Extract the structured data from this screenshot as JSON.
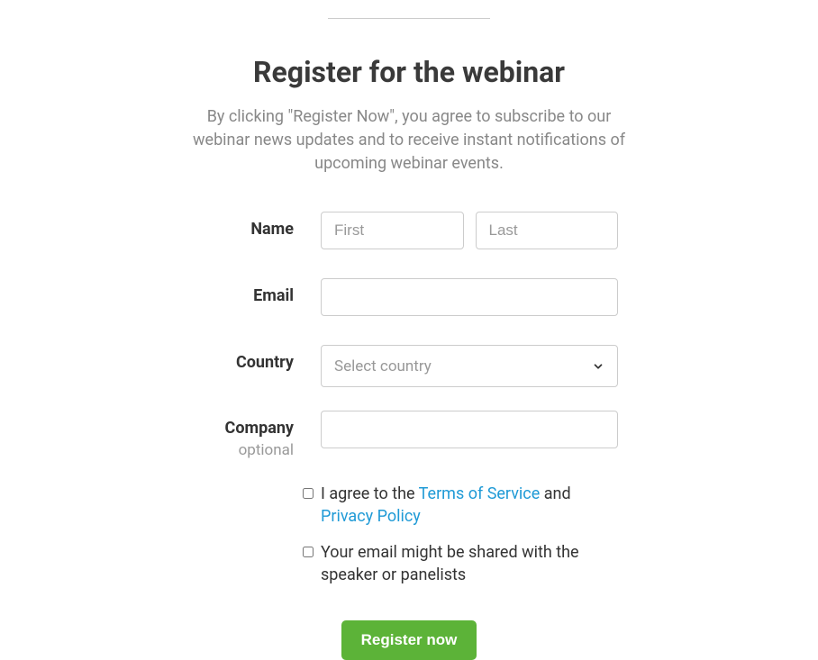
{
  "header": {
    "title": "Register for the webinar",
    "subtitle": "By clicking \"Register Now\", you agree to subscribe to our webinar news updates and to receive instant notifications of upcoming webinar events."
  },
  "form": {
    "name": {
      "label": "Name",
      "first_placeholder": "First",
      "last_placeholder": "Last",
      "first_value": "",
      "last_value": ""
    },
    "email": {
      "label": "Email",
      "value": ""
    },
    "country": {
      "label": "Country",
      "placeholder": "Select country",
      "value": ""
    },
    "company": {
      "label": "Company",
      "sublabel": "optional",
      "value": ""
    },
    "agreements": {
      "tos": {
        "prefix": "I agree to the ",
        "tos_link": "Terms of Service",
        "conj": " and ",
        "pp_link": "Privacy Policy"
      },
      "share_email": "Your email might be shared with the speaker or panelists"
    },
    "submit_label": "Register now"
  }
}
